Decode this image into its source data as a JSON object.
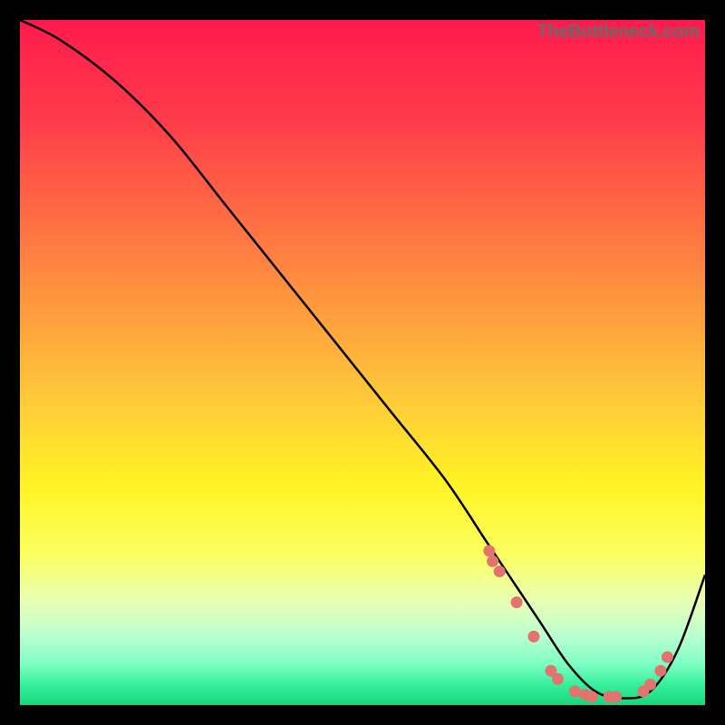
{
  "attribution": "TheBottleneck.com",
  "chart_data": {
    "type": "line",
    "title": "",
    "xlabel": "",
    "ylabel": "",
    "ylim": [
      0,
      100
    ],
    "xlim": [
      0,
      100
    ],
    "curve": {
      "x": [
        0,
        6,
        14,
        22,
        30,
        38,
        46,
        54,
        62,
        68,
        72,
        76,
        80,
        84,
        88,
        92,
        96,
        100
      ],
      "values": [
        100,
        97,
        91,
        83,
        73,
        63,
        53,
        43,
        33,
        24,
        18,
        12,
        6,
        2,
        1,
        2,
        8,
        19
      ]
    },
    "markers": {
      "x": [
        68.5,
        69.0,
        70.0,
        72.5,
        75.0,
        77.5,
        78.5,
        81.0,
        82.5,
        83.5,
        86.0,
        87.0,
        91.0,
        92.0,
        93.5,
        94.5
      ],
      "values": [
        22.5,
        21.0,
        19.5,
        15.0,
        10.0,
        5.0,
        3.8,
        2.0,
        1.5,
        1.2,
        1.2,
        1.2,
        2.0,
        3.0,
        5.0,
        7.0
      ]
    }
  }
}
